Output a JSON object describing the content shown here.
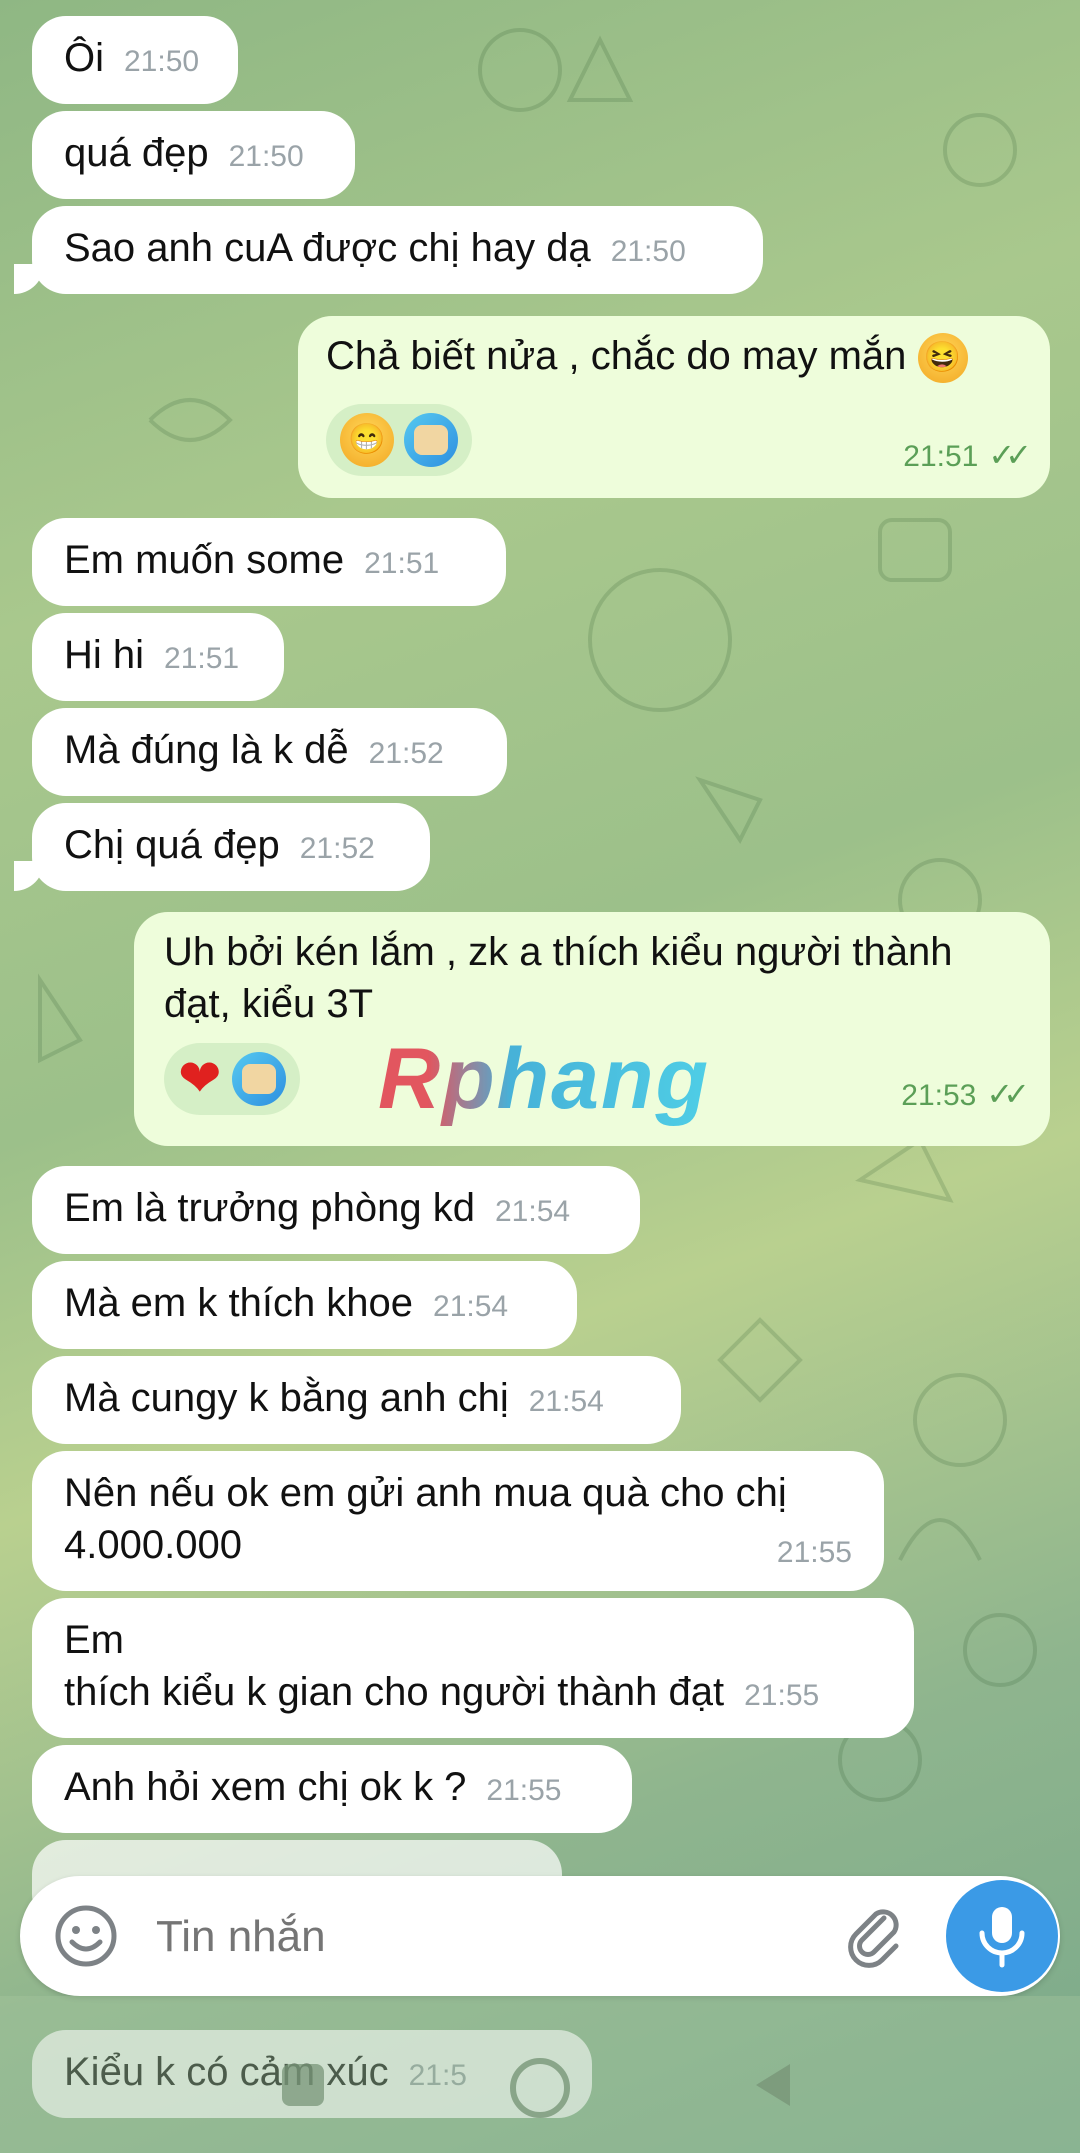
{
  "messages": [
    {
      "id": "m1",
      "dir": "in",
      "text": "Ôi",
      "time": "21:50"
    },
    {
      "id": "m2",
      "dir": "in",
      "text": "quá đẹp",
      "time": "21:50"
    },
    {
      "id": "m3",
      "dir": "in",
      "text": "Sao anh cuA được chị hay dạ",
      "time": "21:50"
    },
    {
      "id": "m4",
      "dir": "out",
      "text": "Chả biết nửa , chắc do may mắn",
      "emoji": "😆",
      "time": "21:51",
      "status": "read"
    },
    {
      "id": "m5",
      "dir": "in",
      "text": "Em muốn some",
      "time": "21:51"
    },
    {
      "id": "m6",
      "dir": "in",
      "text": "Hi hi",
      "time": "21:51"
    },
    {
      "id": "m7",
      "dir": "in",
      "text": "Mà đúng là k dễ",
      "time": "21:52"
    },
    {
      "id": "m8",
      "dir": "in",
      "text": "Chị quá đẹp",
      "time": "21:52"
    },
    {
      "id": "m9",
      "dir": "out",
      "line1": "Uh bởi kén lắm , zk a thích kiểu người thành",
      "line2": "đạt, kiểu 3T",
      "time": "21:53",
      "status": "read"
    },
    {
      "id": "m10",
      "dir": "in",
      "text": "Em là trưởng phòng kd",
      "time": "21:54"
    },
    {
      "id": "m11",
      "dir": "in",
      "text": "Mà em k thích khoe",
      "time": "21:54"
    },
    {
      "id": "m12",
      "dir": "in",
      "text": "Mà cungy k bằng anh chị",
      "time": "21:54"
    },
    {
      "id": "m13",
      "dir": "in",
      "line1": "Nên nếu ok em gửi anh mua quà cho chị",
      "line2": "4.000.000",
      "time": "21:55"
    },
    {
      "id": "m14",
      "dir": "in",
      "line1": "Em",
      "line2": "thích kiểu k gian cho người thành đạt",
      "time": "21:55"
    },
    {
      "id": "m15",
      "dir": "in",
      "text": "Anh hỏi xem chị ok k ?",
      "time": "21:55"
    },
    {
      "id": "m16",
      "dir": "in",
      "text": "Kiểu k có cảm xúc",
      "time": "21:5"
    }
  ],
  "watermark": "Rphang",
  "composer": {
    "placeholder": "Tin nhắn"
  },
  "icons": {
    "emoji": "emoji-icon",
    "attach": "paperclip-icon",
    "mic": "microphone-icon",
    "checks": "double-check-icon",
    "nav_back": "back-triangle-icon",
    "nav_home": "home-circle-icon",
    "nav_recent": "recent-square-icon"
  },
  "colors": {
    "incoming": "#ffffff",
    "outgoing": "#eefddb",
    "accent": "#3b9ae6",
    "time_out": "#5b9f57"
  }
}
